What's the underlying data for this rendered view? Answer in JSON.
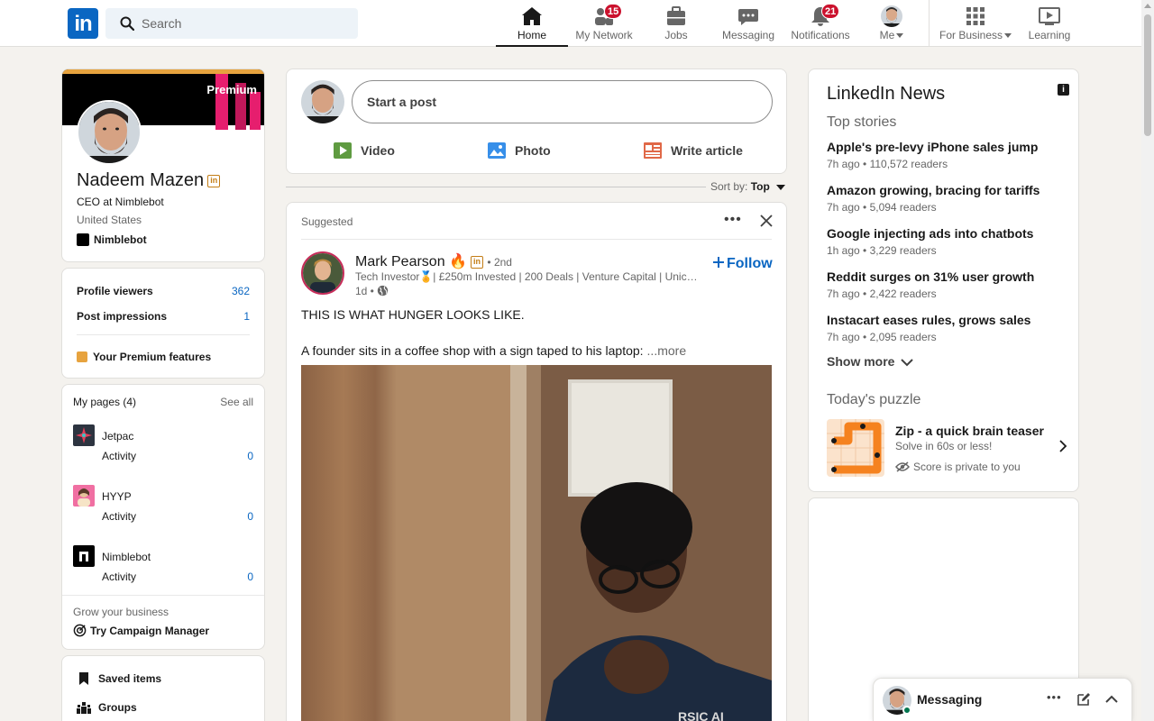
{
  "nav": {
    "search_placeholder": "Search",
    "items": [
      {
        "label": "Home"
      },
      {
        "label": "My Network",
        "badge": "15"
      },
      {
        "label": "Jobs"
      },
      {
        "label": "Messaging"
      },
      {
        "label": "Notifications",
        "badge": "21"
      },
      {
        "label": "Me"
      },
      {
        "label": "For Business"
      },
      {
        "label": "Learning"
      }
    ]
  },
  "profile": {
    "premium": "Premium",
    "name": "Nadeem Mazen",
    "title": "CEO at Nimblebot",
    "location": "United States",
    "company": "Nimblebot"
  },
  "stats": {
    "viewers_label": "Profile viewers",
    "viewers_value": "362",
    "impressions_label": "Post impressions",
    "impressions_value": "1",
    "premium_features": "Your Premium features"
  },
  "pages": {
    "heading": "My pages (4)",
    "see_all": "See all",
    "items": [
      {
        "name": "Jetpac",
        "activity_label": "Activity",
        "activity_value": "0"
      },
      {
        "name": "HYYP",
        "activity_label": "Activity",
        "activity_value": "0"
      },
      {
        "name": "Nimblebot",
        "activity_label": "Activity",
        "activity_value": "0"
      }
    ],
    "grow": "Grow your business",
    "campaign": "Try Campaign Manager"
  },
  "links": {
    "saved": "Saved items",
    "groups": "Groups"
  },
  "share": {
    "placeholder": "Start a post",
    "video": "Video",
    "photo": "Photo",
    "article": "Write article"
  },
  "sort": {
    "label": "Sort by:",
    "value": "Top"
  },
  "post": {
    "tag": "Suggested",
    "author": "Mark Pearson",
    "degree": "• 2nd",
    "headline": "Tech Investor🏅| £250m Invested | 200 Deals | Venture Capital | Unicorn...",
    "time": "1d •",
    "follow": "Follow",
    "line1": "THIS IS WHAT HUNGER LOOKS LIKE.",
    "line2": "A founder sits in a coffee shop with a sign taped to his laptop:",
    "more": "...more"
  },
  "news": {
    "title": "LinkedIn News",
    "subtitle": "Top stories",
    "items": [
      {
        "title": "Apple's pre-levy iPhone sales jump",
        "meta": "7h ago • 110,572 readers"
      },
      {
        "title": "Amazon growing, bracing for tariffs",
        "meta": "7h ago • 5,094 readers"
      },
      {
        "title": "Google injecting ads into chatbots",
        "meta": "1h ago • 3,229 readers"
      },
      {
        "title": "Reddit surges on 31% user growth",
        "meta": "7h ago • 2,422 readers"
      },
      {
        "title": "Instacart eases rules, grows sales",
        "meta": "7h ago • 2,095 readers"
      }
    ],
    "show_more": "Show more",
    "puzzle_heading": "Today's puzzle",
    "puzzle_name": "Zip - a quick brain teaser",
    "puzzle_desc": "Solve in 60s or less!",
    "puzzle_privacy": "Score is private to you"
  },
  "messaging": {
    "label": "Messaging"
  },
  "colors": {
    "brand": "#0a66c2",
    "badge": "#cb112d",
    "premium_gold": "#c37d16"
  }
}
